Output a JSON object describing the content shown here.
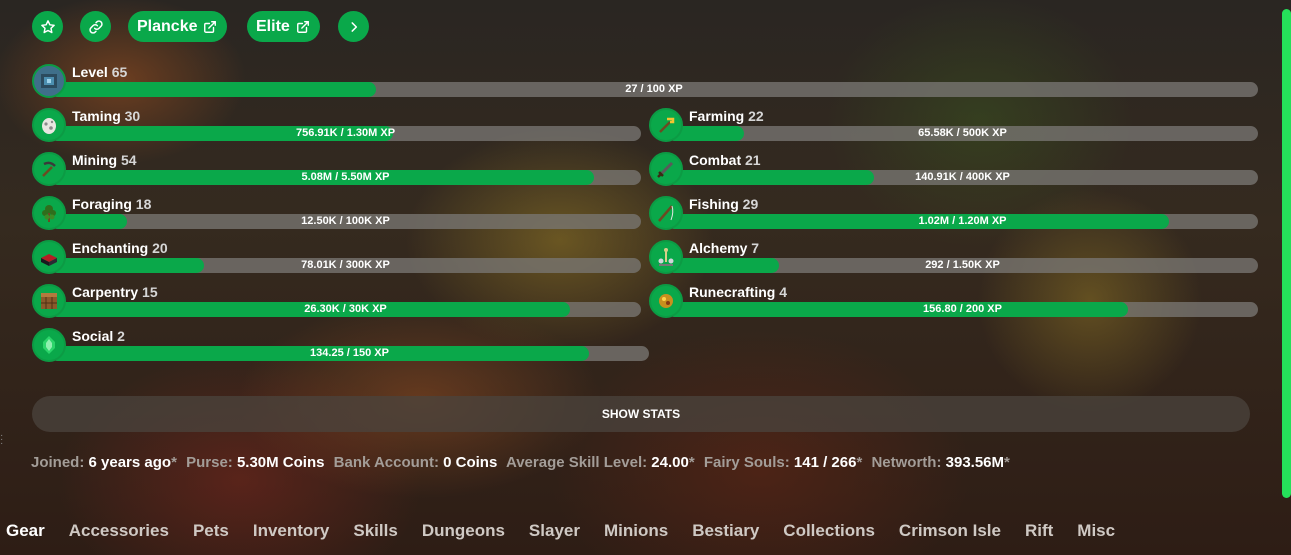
{
  "header": {
    "plancke_label": "Plancke",
    "elite_label": "Elite"
  },
  "level": {
    "name": "Level",
    "level": "65",
    "xp": "27 / 100 XP",
    "progress": 0.27
  },
  "skills": [
    {
      "name": "Taming",
      "level": "30",
      "xp": "756.91K / 1.30M XP",
      "progress": 0.58,
      "icon": "spawn-egg-icon"
    },
    {
      "name": "Farming",
      "level": "22",
      "xp": "65.58K / 500K XP",
      "progress": 0.13,
      "icon": "golden-hoe-icon"
    },
    {
      "name": "Mining",
      "level": "54",
      "xp": "5.08M / 5.50M XP",
      "progress": 0.92,
      "icon": "pickaxe-icon"
    },
    {
      "name": "Combat",
      "level": "21",
      "xp": "140.91K / 400K XP",
      "progress": 0.35,
      "icon": "sword-icon"
    },
    {
      "name": "Foraging",
      "level": "18",
      "xp": "12.50K / 100K XP",
      "progress": 0.13,
      "icon": "sapling-icon"
    },
    {
      "name": "Fishing",
      "level": "29",
      "xp": "1.02M / 1.20M XP",
      "progress": 0.85,
      "icon": "fishing-rod-icon"
    },
    {
      "name": "Enchanting",
      "level": "20",
      "xp": "78.01K / 300K XP",
      "progress": 0.26,
      "icon": "enchanting-table-icon"
    },
    {
      "name": "Alchemy",
      "level": "7",
      "xp": "292 / 1.50K XP",
      "progress": 0.19,
      "icon": "brewing-stand-icon"
    },
    {
      "name": "Carpentry",
      "level": "15",
      "xp": "26.30K / 30K XP",
      "progress": 0.88,
      "icon": "crafting-table-icon"
    },
    {
      "name": "Runecrafting",
      "level": "4",
      "xp": "156.80 / 200 XP",
      "progress": 0.78,
      "icon": "magma-cream-icon"
    },
    {
      "name": "Social",
      "level": "2",
      "xp": "134.25 / 150 XP",
      "progress": 0.9,
      "icon": "emerald-icon"
    }
  ],
  "show_stats_label": "SHOW STATS",
  "info": {
    "joined_label": "Joined:",
    "joined_value": "6 years ago",
    "purse_label": "Purse:",
    "purse_value": "5.30M Coins",
    "bank_label": "Bank Account:",
    "bank_value": "0 Coins",
    "avg_label": "Average Skill Level:",
    "avg_value": "24.00",
    "souls_label": "Fairy Souls:",
    "souls_value": "141 / 266",
    "networth_label": "Networth:",
    "networth_value": "393.56M",
    "star": "*"
  },
  "tabs": [
    "Gear",
    "Accessories",
    "Pets",
    "Inventory",
    "Skills",
    "Dungeons",
    "Slayer",
    "Minions",
    "Bestiary",
    "Collections",
    "Crimson Isle",
    "Rift",
    "Misc"
  ],
  "colors": {
    "accent": "#0aa84a",
    "bar_track": "#787672",
    "scrollbar": "#25e05a"
  }
}
